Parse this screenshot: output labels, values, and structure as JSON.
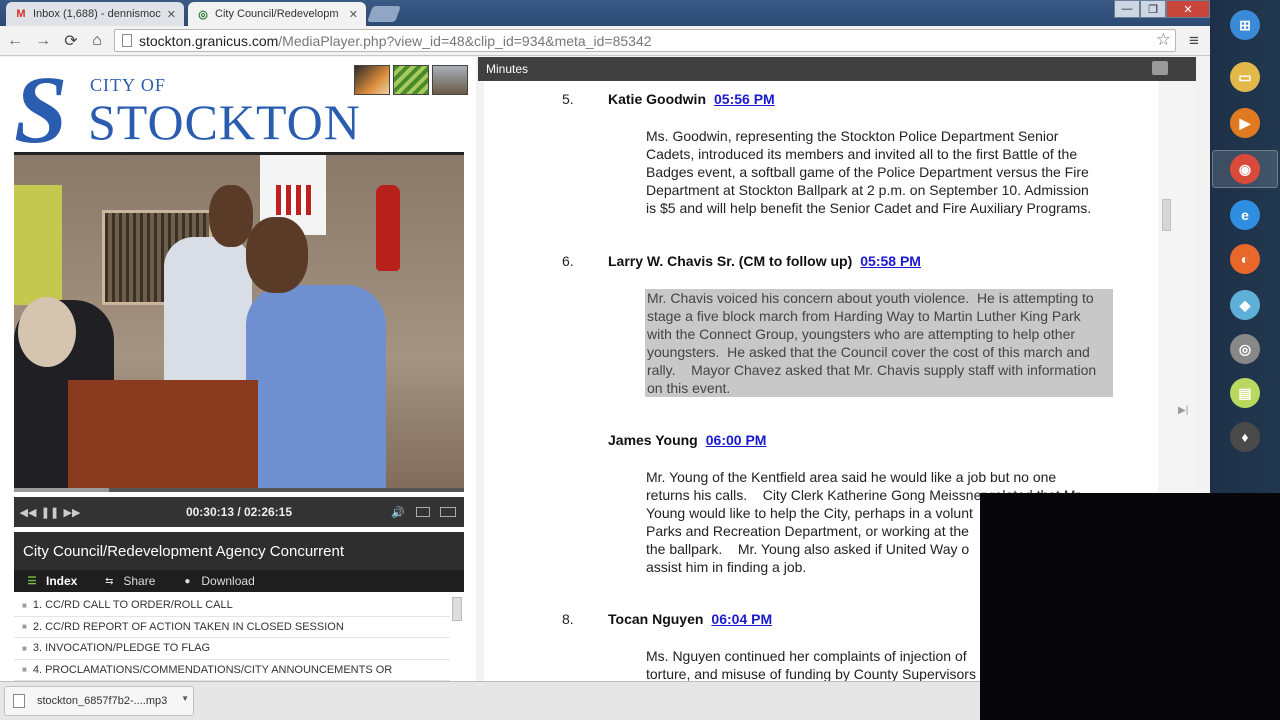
{
  "browser": {
    "tabs": [
      {
        "title": "Inbox (1,688) - dennismoc",
        "favicon": "gmail-icon",
        "active": false
      },
      {
        "title": "City Council/Redevelopm",
        "favicon": "granicus-icon",
        "active": true
      }
    ],
    "tab_close_glyph": "✕",
    "window_buttons": {
      "minimize": "—",
      "maximize": "❐",
      "close": "✕"
    },
    "nav": {
      "back": "←",
      "forward": "→",
      "reload": "⟳",
      "home": "⌂"
    },
    "url_host": "stockton.granicus.com",
    "url_path": "/MediaPlayer.php?view_id=48&clip_id=934&meta_id=85342",
    "star_glyph": "☆",
    "menu_glyph": "≡"
  },
  "logo": {
    "city_of": "CITY OF",
    "name": "STOCKTON",
    "s": "S"
  },
  "player": {
    "controls": {
      "rewind": "◀◀",
      "pause": "❚❚",
      "forward": "▶▶",
      "volume": "🔊"
    },
    "timecode": "00:30:13 / 02:26:15",
    "progress_fraction": 0.21,
    "title": "City Council/Redevelopment Agency Concurrent",
    "tabs": [
      {
        "label": "Index",
        "icon": "list-icon",
        "glyph": "☰"
      },
      {
        "label": "Share",
        "icon": "share-icon",
        "glyph": "⇆"
      },
      {
        "label": "Download",
        "icon": "download-icon",
        "glyph": "●"
      }
    ],
    "index_items": [
      "1. CC/RD CALL TO ORDER/ROLL CALL",
      "2. CC/RD REPORT OF ACTION TAKEN IN CLOSED SESSION",
      "3. INVOCATION/PLEDGE TO FLAG",
      "4. PROCLAMATIONS/COMMENDATIONS/CITY ANNOUNCEMENTS OR"
    ]
  },
  "minutes": {
    "header": "Minutes",
    "entries": [
      {
        "num": "5.",
        "name": "Katie Goodwin",
        "time": "05:56 PM",
        "body_lines": [
          "Ms. Goodwin, representing the Stockton Police Department Senior",
          "Cadets, introduced its members and invited all to the first Battle of the",
          "Badges event, a softball game of the Police Department versus the Fire",
          "Department at Stockton Ballpark at 2 p.m. on September 10. Admission",
          "is $5 and will help benefit the Senior Cadet and Fire Auxiliary Programs."
        ],
        "highlighted": false
      },
      {
        "num": "6.",
        "name": "Larry W. Chavis Sr. (CM to follow up)",
        "time": "05:58 PM",
        "body_lines": [
          "Mr. Chavis voiced his concern about youth violence.  He is attempting to",
          "stage a five block march from Harding Way to Martin Luther King Park",
          "with the Connect Group, youngsters who are attempting to help other",
          "youngsters.  He asked that the Council cover the cost of this march and",
          "rally.    Mayor Chavez asked that Mr. Chavis supply staff with information",
          "on this event."
        ],
        "highlighted": true
      },
      {
        "num": "",
        "name": "James Young",
        "time": "06:00 PM",
        "body_lines": [
          "Mr. Young of the Kentfield area said he would like a job but no one",
          "returns his calls.    City Clerk Katherine Gong Meissner related that Mr.",
          "Young would like to help the City, perhaps in a volunt",
          "Parks and Recreation Department, or working at the",
          "the ballpark.    Mr. Young also asked if United Way o",
          "assist him in finding a job."
        ],
        "highlighted": false
      },
      {
        "num": "8.",
        "name": "Tocan Nguyen",
        "time": "06:04 PM",
        "body_lines": [
          "Ms. Nguyen continued her complaints of injection of",
          "torture, and misuse of funding by County Supervisors"
        ],
        "highlighted": false
      }
    ]
  },
  "download_bar": {
    "filename": "stockton_6857f7b2-....mp3",
    "dropdown_glyph": "▼"
  },
  "taskbar": {
    "items": [
      {
        "icon": "windows-start-icon",
        "glyph": "⊞",
        "color": "#3a8ad8"
      },
      {
        "icon": "file-explorer-icon",
        "glyph": "▭",
        "color": "#e2b84a"
      },
      {
        "icon": "media-player-icon",
        "glyph": "▶",
        "color": "#e07a20"
      },
      {
        "icon": "chrome-icon",
        "glyph": "◉",
        "color": "#d94a3a"
      },
      {
        "icon": "internet-explorer-icon",
        "glyph": "e",
        "color": "#2f8ee0"
      },
      {
        "icon": "firefox-icon",
        "glyph": "◐",
        "color": "#e8672a"
      },
      {
        "icon": "app-icon",
        "glyph": "◆",
        "color": "#5fb0d8"
      },
      {
        "icon": "app-icon-2",
        "glyph": "◎",
        "color": "#888888"
      },
      {
        "icon": "sticky-notes-icon",
        "glyph": "▤",
        "color": "#b8d860"
      },
      {
        "icon": "app-icon-3",
        "glyph": "♦",
        "color": "#4a4a4a"
      }
    ]
  }
}
